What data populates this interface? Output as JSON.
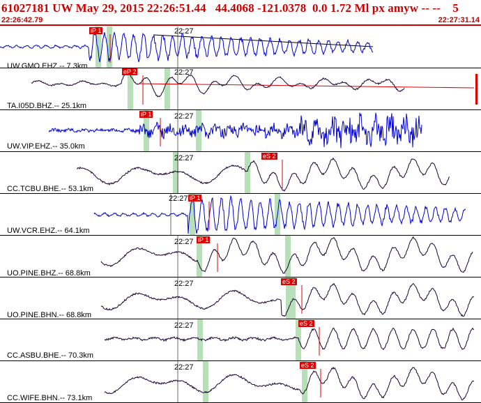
{
  "header": {
    "title": "61027181 UW May 29, 2015 22:26:51.44   44.4068 -121.0378  0.0 1.72 Ml px amyw -- --    5",
    "start_time": "22:26:42.79",
    "end_time": "22:27:31.14"
  },
  "time_tick_label": "22:27",
  "colors": {
    "header_red": "#cc0000",
    "pick_red": "#e00000",
    "trace_blue": "#0000cc",
    "trace_black": "#1a0033",
    "window_green": "#b8e0b8"
  },
  "traces": [
    {
      "label": "UW.GMO.EHZ.-- 7.3km",
      "color": "blue",
      "pick": "iP 1",
      "style": "hf"
    },
    {
      "label": "TA.I05D.BHZ.-- 25.1km",
      "color": "black",
      "pick": "eP 2",
      "style": "mixed"
    },
    {
      "label": "UW.VIP.EHZ.-- 35.0km",
      "color": "blue",
      "pick": "iP 1",
      "style": "noisy"
    },
    {
      "label": "CC.TCBU.BHE.-- 53.1km",
      "color": "black",
      "pick": "eS 2",
      "style": "lf"
    },
    {
      "label": "UW.VCR.EHZ.-- 64.1km",
      "color": "blue",
      "pick": "iP 1",
      "style": "hf"
    },
    {
      "label": "UO.PINE.BHZ.-- 68.8km",
      "color": "black",
      "pick": "iP 1",
      "style": "lf"
    },
    {
      "label": "UO.PINE.BHN.-- 68.8km",
      "color": "black",
      "pick": "eS 2",
      "style": "lf"
    },
    {
      "label": "CC.ASBU.BHE.-- 70.3km",
      "color": "black",
      "pick": "eS 2",
      "style": "flat"
    },
    {
      "label": "CC.WIFE.BHN.-- 73.1km",
      "color": "black",
      "pick": "eS 2",
      "style": "lf"
    }
  ]
}
